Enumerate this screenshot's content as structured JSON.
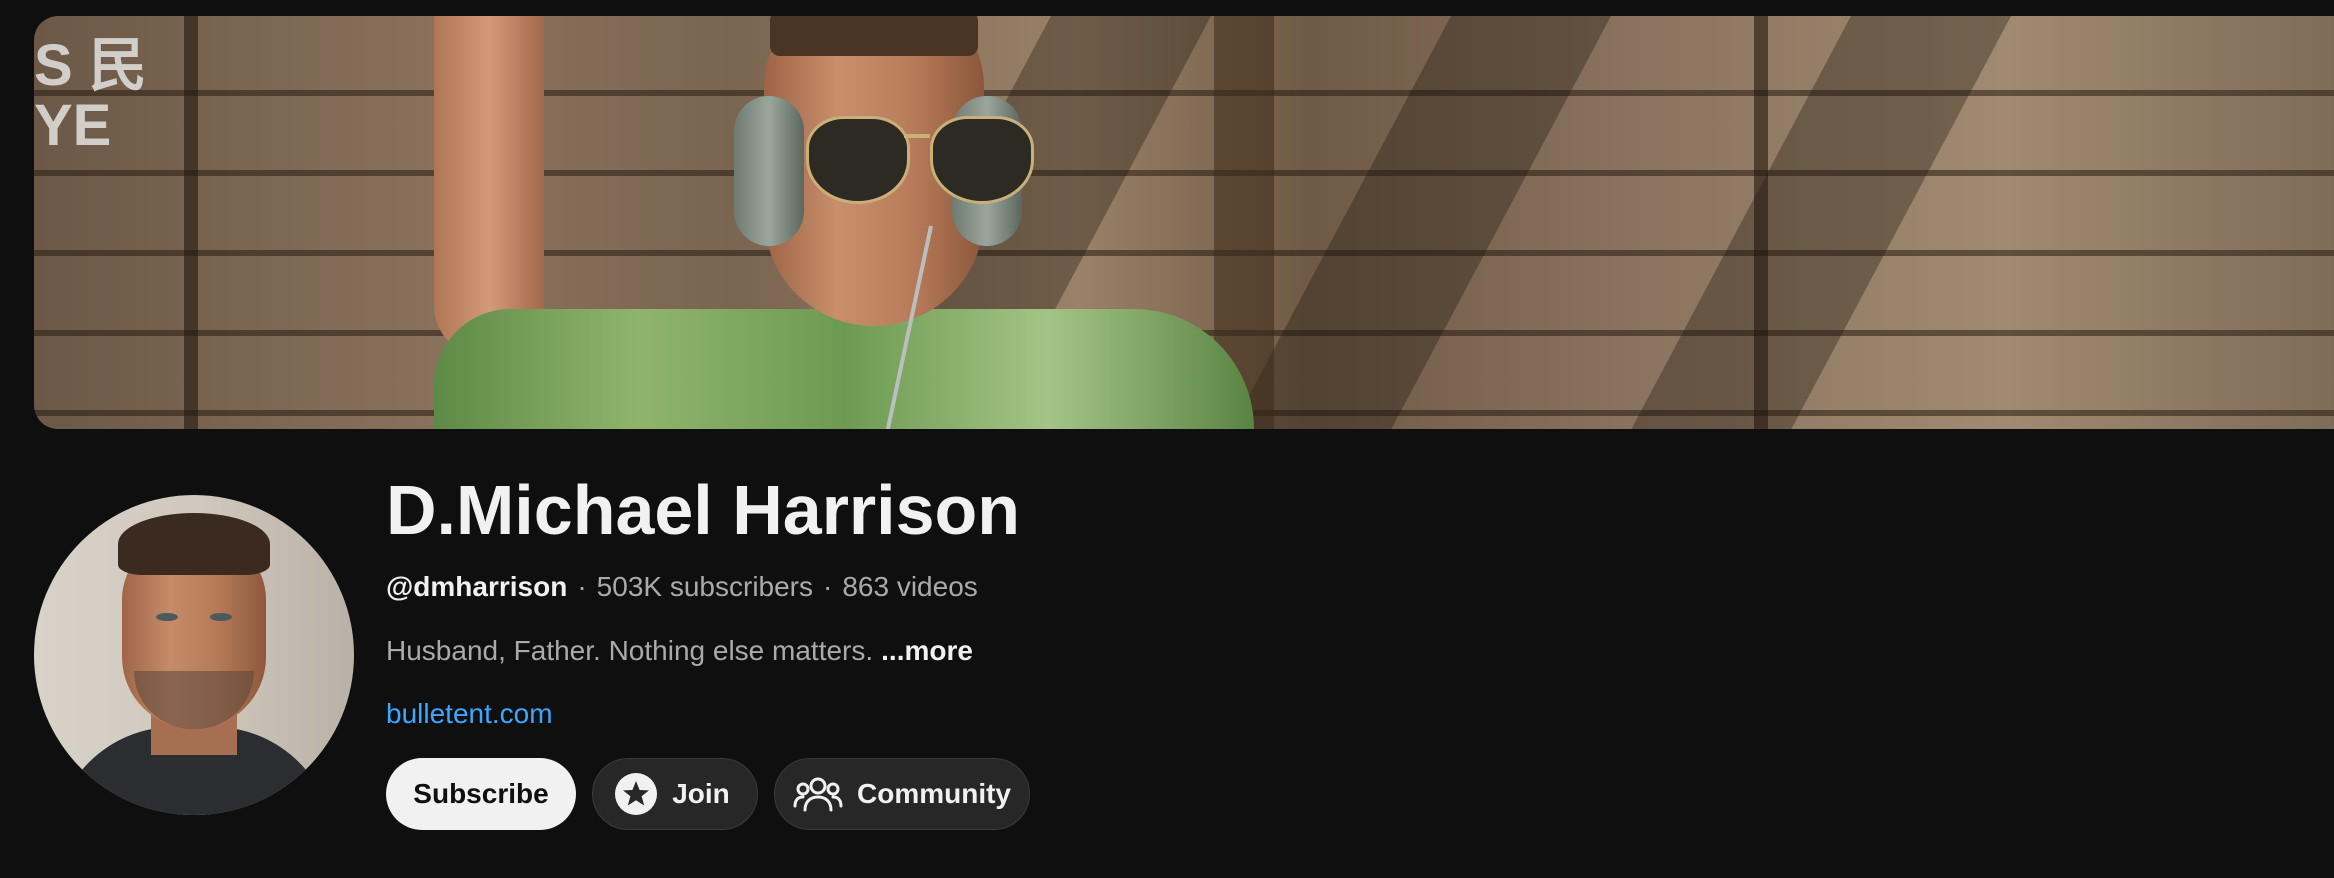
{
  "banner": {
    "sign_text_line1": "S 民",
    "sign_text_line2": "YE"
  },
  "channel": {
    "name": "D.Michael Harrison",
    "handle": "@dmharrison",
    "subscribers": "503K subscribers",
    "videos": "863 videos",
    "separator": "·",
    "description": "Husband, Father. Nothing else matters.",
    "more_label": "...more",
    "link": "bulletent.com"
  },
  "actions": {
    "subscribe_label": "Subscribe",
    "join_label": "Join",
    "community_label": "Community"
  },
  "icons": {
    "join": "star-circle-icon",
    "community": "people-icon"
  },
  "colors": {
    "background": "#0f0f0f",
    "link": "#3ea6ff",
    "subscribe_bg": "#f1f1f1",
    "secondary_button_bg": "#272727"
  }
}
